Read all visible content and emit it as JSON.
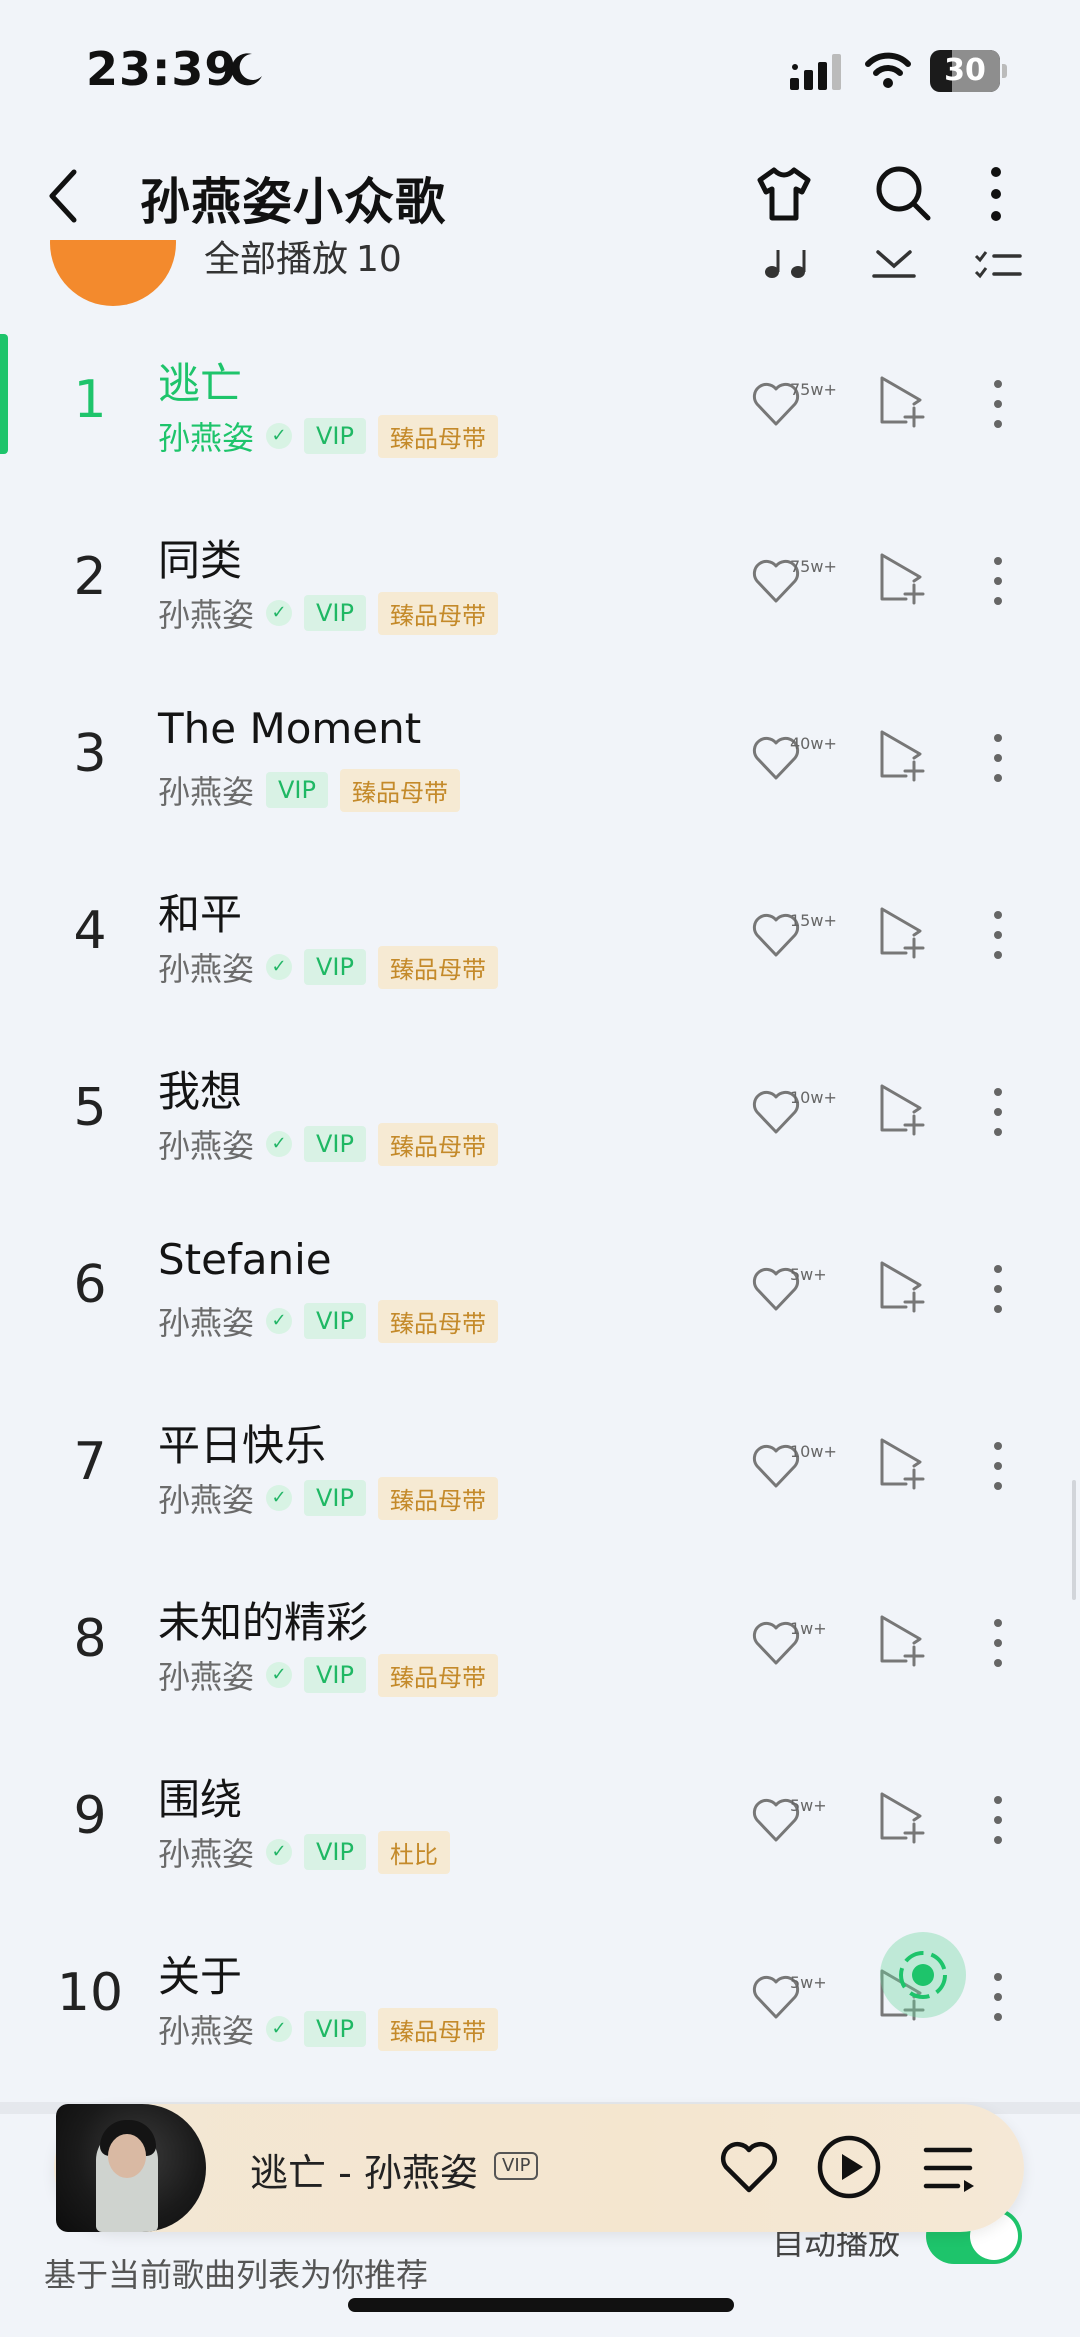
{
  "status_bar": {
    "time": "23:39",
    "battery": "30"
  },
  "header": {
    "title": "孙燕姿小众歌"
  },
  "play_all": {
    "label": "全部播放",
    "count": "10"
  },
  "songs": [
    {
      "index": "1",
      "title": "逃亡",
      "artist": "孙燕姿",
      "vip": "VIP",
      "quality": "臻品母带",
      "likes": "75w+",
      "active": true,
      "verified": true
    },
    {
      "index": "2",
      "title": "同类",
      "artist": "孙燕姿",
      "vip": "VIP",
      "quality": "臻品母带",
      "likes": "75w+",
      "verified": true
    },
    {
      "index": "3",
      "title": "The Moment",
      "artist": "孙燕姿",
      "vip": "VIP",
      "quality": "臻品母带",
      "likes": "40w+",
      "verified": false
    },
    {
      "index": "4",
      "title": "和平",
      "artist": "孙燕姿",
      "vip": "VIP",
      "quality": "臻品母带",
      "likes": "15w+",
      "verified": true
    },
    {
      "index": "5",
      "title": "我想",
      "artist": "孙燕姿",
      "vip": "VIP",
      "quality": "臻品母带",
      "likes": "10w+",
      "verified": true
    },
    {
      "index": "6",
      "title": "Stefanie",
      "artist": "孙燕姿",
      "vip": "VIP",
      "quality": "臻品母带",
      "likes": "5w+",
      "verified": true
    },
    {
      "index": "7",
      "title": "平日快乐",
      "artist": "孙燕姿",
      "vip": "VIP",
      "quality": "臻品母带",
      "likes": "10w+",
      "verified": true
    },
    {
      "index": "8",
      "title": "未知的精彩",
      "artist": "孙燕姿",
      "vip": "VIP",
      "quality": "臻品母带",
      "likes": "1w+",
      "verified": true
    },
    {
      "index": "9",
      "title": "围绕",
      "artist": "孙燕姿",
      "vip": "VIP",
      "quality": "杜比",
      "likes": "5w+",
      "verified": true
    },
    {
      "index": "10",
      "title": "关于",
      "artist": "孙燕姿",
      "vip": "VIP",
      "quality": "臻品母带",
      "likes": "5w+",
      "verified": true
    }
  ],
  "recommend": {
    "subtitle": "基于当前歌曲列表为你推荐",
    "autoplay_label": "自动播放",
    "autoplay_on": true
  },
  "mini_player": {
    "title": "逃亡 - 孙燕姿",
    "vip_badge": "VIP"
  },
  "colors": {
    "accent_green": "#1ec46b",
    "play_orange": "#f38a2d",
    "quality_gold": "#c48a2a",
    "background": "#f1f4f9"
  },
  "icons": [
    "moon-icon",
    "signal-icon",
    "wifi-icon",
    "back-icon",
    "skin-shirt-icon",
    "search-icon",
    "more-vertical-icon",
    "music-note-icon",
    "download-icon",
    "multi-select-icon",
    "heart-icon",
    "add-to-playlist-icon",
    "radar-icon",
    "play-icon",
    "queue-icon"
  ]
}
